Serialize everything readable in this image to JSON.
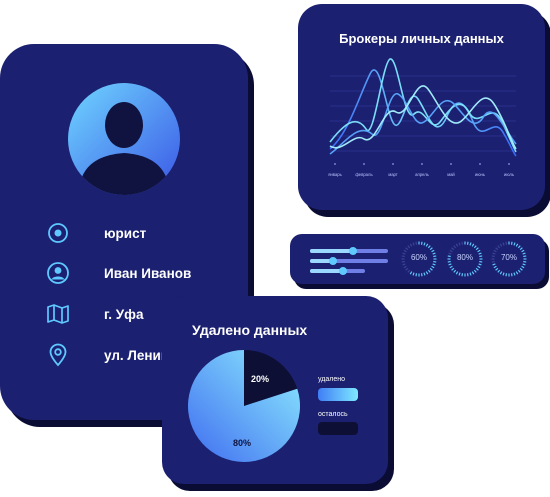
{
  "profile": {
    "items": [
      {
        "icon": "target-icon",
        "label": "юрист"
      },
      {
        "icon": "user-icon",
        "label": "Иван Иванов"
      },
      {
        "icon": "map-icon",
        "label": "г. Уфа"
      },
      {
        "icon": "location-pin-icon",
        "label": "ул. Ленина"
      }
    ]
  },
  "brokers_card": {
    "title": "Брокеры личных данных",
    "x_labels": [
      "январь",
      "февраль",
      "март",
      "апрель",
      "май",
      "июнь",
      "июль"
    ]
  },
  "settings": {
    "sliders": [
      0.55,
      0.3,
      0.6
    ],
    "gauges": [
      {
        "label": "60%",
        "value": 60
      },
      {
        "label": "80%",
        "value": 80
      },
      {
        "label": "70%",
        "value": 70
      }
    ]
  },
  "removed_card": {
    "title": "Удалено данных",
    "legend": [
      {
        "label": "удалено",
        "color": "#5fd0ff"
      },
      {
        "label": "осталось",
        "color": "#0d0f35"
      }
    ]
  },
  "colors": {
    "card": "#1b2070",
    "accent": "#5fd0ff",
    "dark": "#0d0f35"
  },
  "chart_data": {
    "type": "pie",
    "categories": [
      "20%",
      "80%"
    ],
    "values": [
      20,
      80
    ]
  }
}
